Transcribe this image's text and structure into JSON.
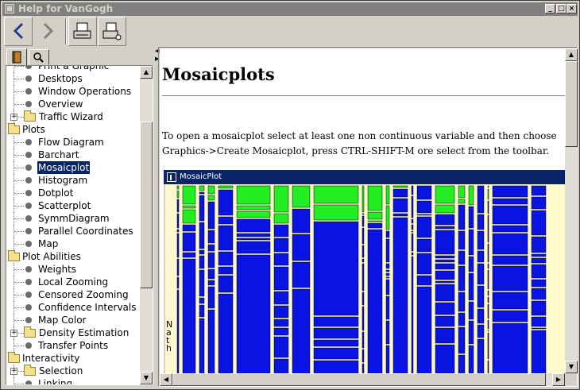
{
  "window": {
    "title": "Help for VanGogh",
    "min": "_",
    "max": "□",
    "close": "×"
  },
  "toolbar": {
    "back": "back",
    "forward": "forward",
    "print": "print",
    "print_setup": "print-setup"
  },
  "tabs": [
    {
      "icon": "book-icon"
    },
    {
      "icon": "search-icon"
    }
  ],
  "tree": {
    "items": [
      {
        "label": "Print a Graphic",
        "type": "leaf",
        "depth": 1
      },
      {
        "label": "Desktops",
        "type": "leaf",
        "depth": 1
      },
      {
        "label": "Window Operations",
        "type": "leaf",
        "depth": 1
      },
      {
        "label": "Overview",
        "type": "leaf",
        "depth": 1
      },
      {
        "label": "Traffic Wizard",
        "type": "folder",
        "depth": 1,
        "expander": "+"
      },
      {
        "label": "Plots",
        "type": "folder",
        "depth": 0
      },
      {
        "label": "Flow Diagram",
        "type": "leaf",
        "depth": 1
      },
      {
        "label": "Barchart",
        "type": "leaf",
        "depth": 1
      },
      {
        "label": "Mosaicplot",
        "type": "leaf",
        "depth": 1,
        "selected": true
      },
      {
        "label": "Histogram",
        "type": "leaf",
        "depth": 1
      },
      {
        "label": "Dotplot",
        "type": "leaf",
        "depth": 1
      },
      {
        "label": "Scatterplot",
        "type": "leaf",
        "depth": 1
      },
      {
        "label": "SymmDiagram",
        "type": "leaf",
        "depth": 1
      },
      {
        "label": "Parallel Coordinates",
        "type": "leaf",
        "depth": 1
      },
      {
        "label": "Map",
        "type": "leaf",
        "depth": 1
      },
      {
        "label": "Plot Abilities",
        "type": "folder",
        "depth": 0
      },
      {
        "label": "Weights",
        "type": "leaf",
        "depth": 1
      },
      {
        "label": "Local Zooming",
        "type": "leaf",
        "depth": 1
      },
      {
        "label": "Censored Zooming",
        "type": "leaf",
        "depth": 1
      },
      {
        "label": "Confidence Intervals",
        "type": "leaf",
        "depth": 1
      },
      {
        "label": "Map Color",
        "type": "leaf",
        "depth": 1
      },
      {
        "label": "Density Estimation",
        "type": "folder",
        "depth": 1,
        "expander": "+"
      },
      {
        "label": "Transfer Points",
        "type": "leaf",
        "depth": 1
      },
      {
        "label": "Interactivity",
        "type": "folder",
        "depth": 0
      },
      {
        "label": "Selection",
        "type": "folder",
        "depth": 1,
        "expander": "+"
      },
      {
        "label": "Linking",
        "type": "leaf",
        "depth": 1
      }
    ]
  },
  "doc": {
    "title": "Mosaicplots",
    "paragraph": "To open a mosaicplot select at least one non continuous variable and then choose Graphics->Create Mosaicplot, press CTRL-SHIFT-M ore select from the toolbar."
  },
  "mosaic_window": {
    "title": "MosaicPlot",
    "axis_label": "Nath",
    "colors": {
      "highlight": "#22ee22",
      "base": "#0a14e0",
      "background": "#fffacd",
      "title_bar": "#0a246a"
    }
  }
}
